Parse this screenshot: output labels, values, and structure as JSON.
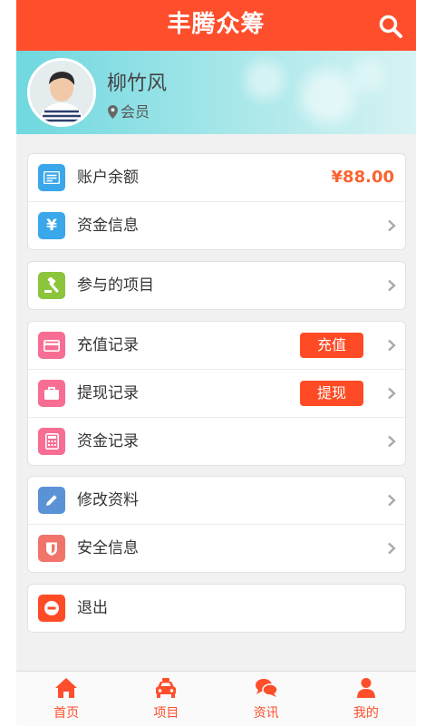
{
  "app": {
    "title": "丰腾众筹"
  },
  "profile": {
    "name": "柳竹风",
    "role": "会员"
  },
  "account": {
    "balance_label": "账户余额",
    "balance_value": "¥88.00",
    "funds_info_label": "资金信息"
  },
  "projects": {
    "participated_label": "参与的项目"
  },
  "records": {
    "recharge_label": "充值记录",
    "recharge_button": "充值",
    "withdraw_label": "提现记录",
    "withdraw_button": "提现",
    "funds_label": "资金记录"
  },
  "settings": {
    "edit_profile_label": "修改资料",
    "security_label": "安全信息"
  },
  "logout": {
    "label": "退出"
  },
  "tabbar": [
    {
      "label": "首页",
      "icon": "home-icon"
    },
    {
      "label": "项目",
      "icon": "taxi-icon"
    },
    {
      "label": "资讯",
      "icon": "chat-icon"
    },
    {
      "label": "我的",
      "icon": "user-icon"
    }
  ],
  "colors": {
    "brand": "#fe4e2c",
    "balance": "#fb6330",
    "wallet_icon": "#3aa7ea",
    "funds_icon": "#3aa7ea",
    "project_icon": "#8cc43c",
    "record_icons": "#f76d93",
    "edit_icon": "#5b92d6",
    "security_icon": "#f0746a",
    "logout_icon": "#fe4b25"
  }
}
